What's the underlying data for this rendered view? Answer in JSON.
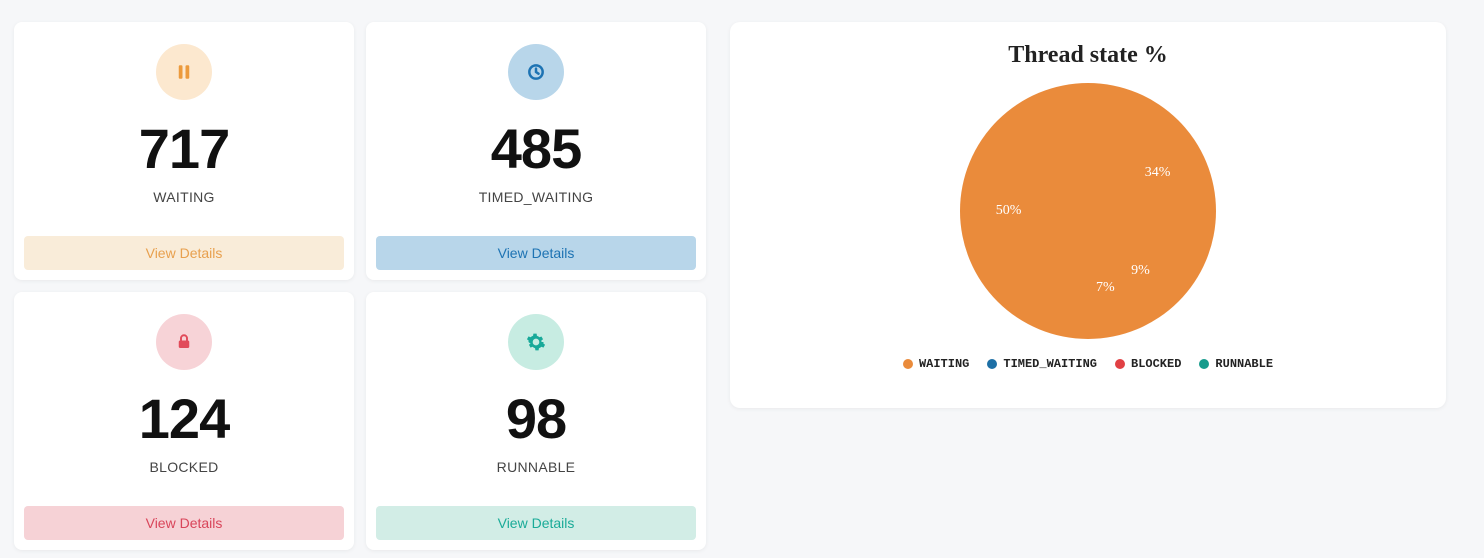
{
  "cards": {
    "waiting": {
      "value": "717",
      "label": "WAITING",
      "button": "View Details",
      "color": "#ec9a3c"
    },
    "timed_waiting": {
      "value": "485",
      "label": "TIMED_WAITING",
      "button": "View Details",
      "color": "#1d73b3"
    },
    "blocked": {
      "value": "124",
      "label": "BLOCKED",
      "button": "View Details",
      "color": "#e14b5a"
    },
    "runnable": {
      "value": "98",
      "label": "RUNNABLE",
      "button": "View Details",
      "color": "#18a999"
    }
  },
  "chart": {
    "title": "Thread state %"
  },
  "legend": {
    "waiting": "WAITING",
    "timed_waiting": "TIMED_WAITING",
    "blocked": "BLOCKED",
    "runnable": "RUNNABLE"
  },
  "colors": {
    "waiting": "#ea8b3b",
    "timed_waiting": "#1d6fa5",
    "blocked": "#e14044",
    "runnable": "#169b8c"
  },
  "chart_data": {
    "type": "pie",
    "title": "Thread state %",
    "series": [
      {
        "name": "WAITING",
        "value": 50,
        "label": "50%",
        "color": "#ea8b3b"
      },
      {
        "name": "TIMED_WAITING",
        "value": 34,
        "label": "34%",
        "color": "#1d6fa5"
      },
      {
        "name": "BLOCKED",
        "value": 9,
        "label": "9%",
        "color": "#e14044"
      },
      {
        "name": "RUNNABLE",
        "value": 7,
        "label": "7%",
        "color": "#169b8c"
      }
    ]
  }
}
